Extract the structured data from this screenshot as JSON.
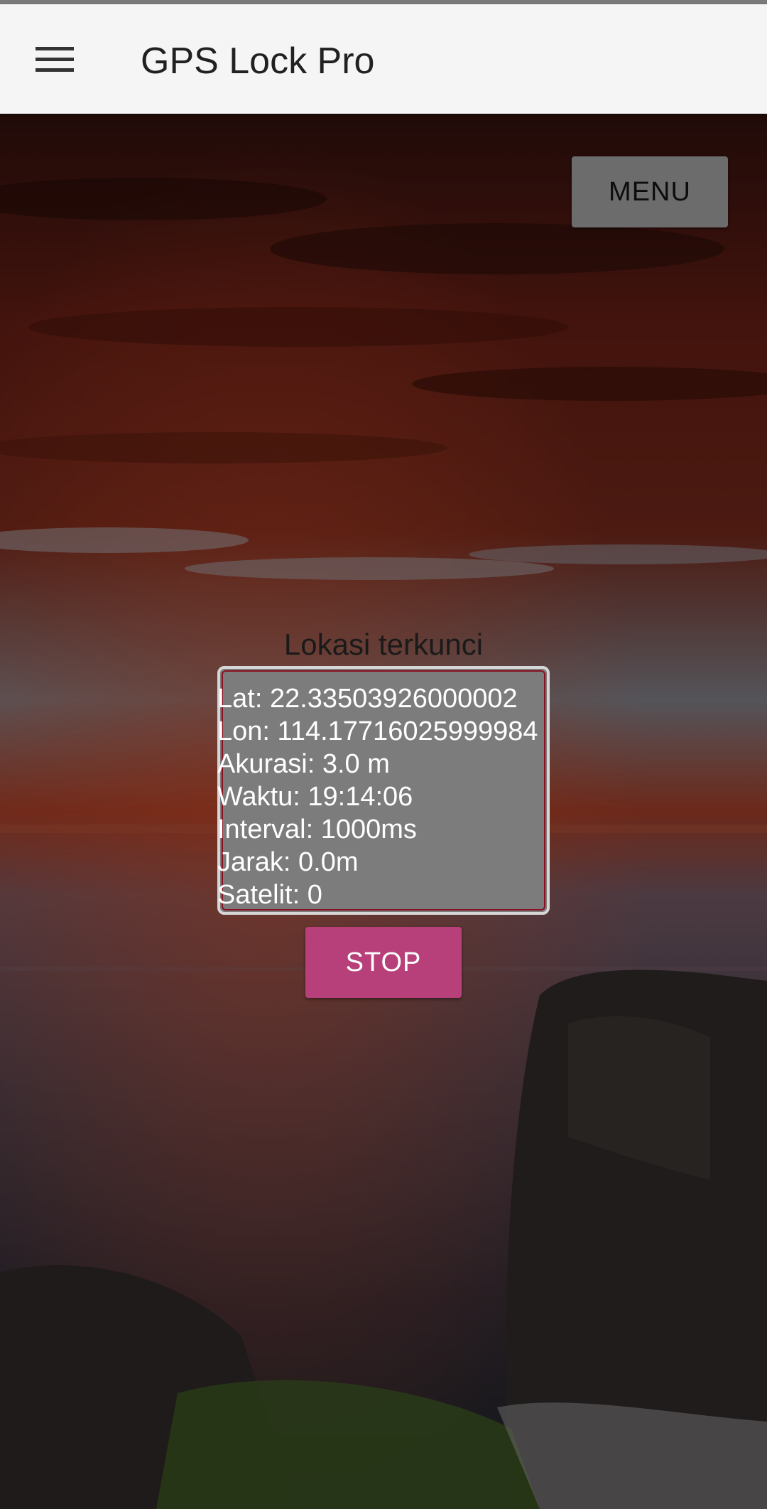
{
  "app_bar": {
    "title": "GPS Lock Pro",
    "menu_icon": "hamburger-menu-icon",
    "background": "#f5f5f5"
  },
  "actions": {
    "menu_label": "MENU",
    "stop_label": "STOP",
    "stop_color": "#b8407a"
  },
  "status": {
    "label": "Lokasi terkunci"
  },
  "location_info": {
    "lat": "Lat: 22.33503926000002",
    "lon": "Lon: 114.17716025999984",
    "accuracy": "Akurasi: 3.0 m",
    "time": "Waktu: 19:14:06",
    "interval": "Interval: 1000ms",
    "distance": "Jarak: 0.0m",
    "satellites": "Satelit: 0"
  }
}
